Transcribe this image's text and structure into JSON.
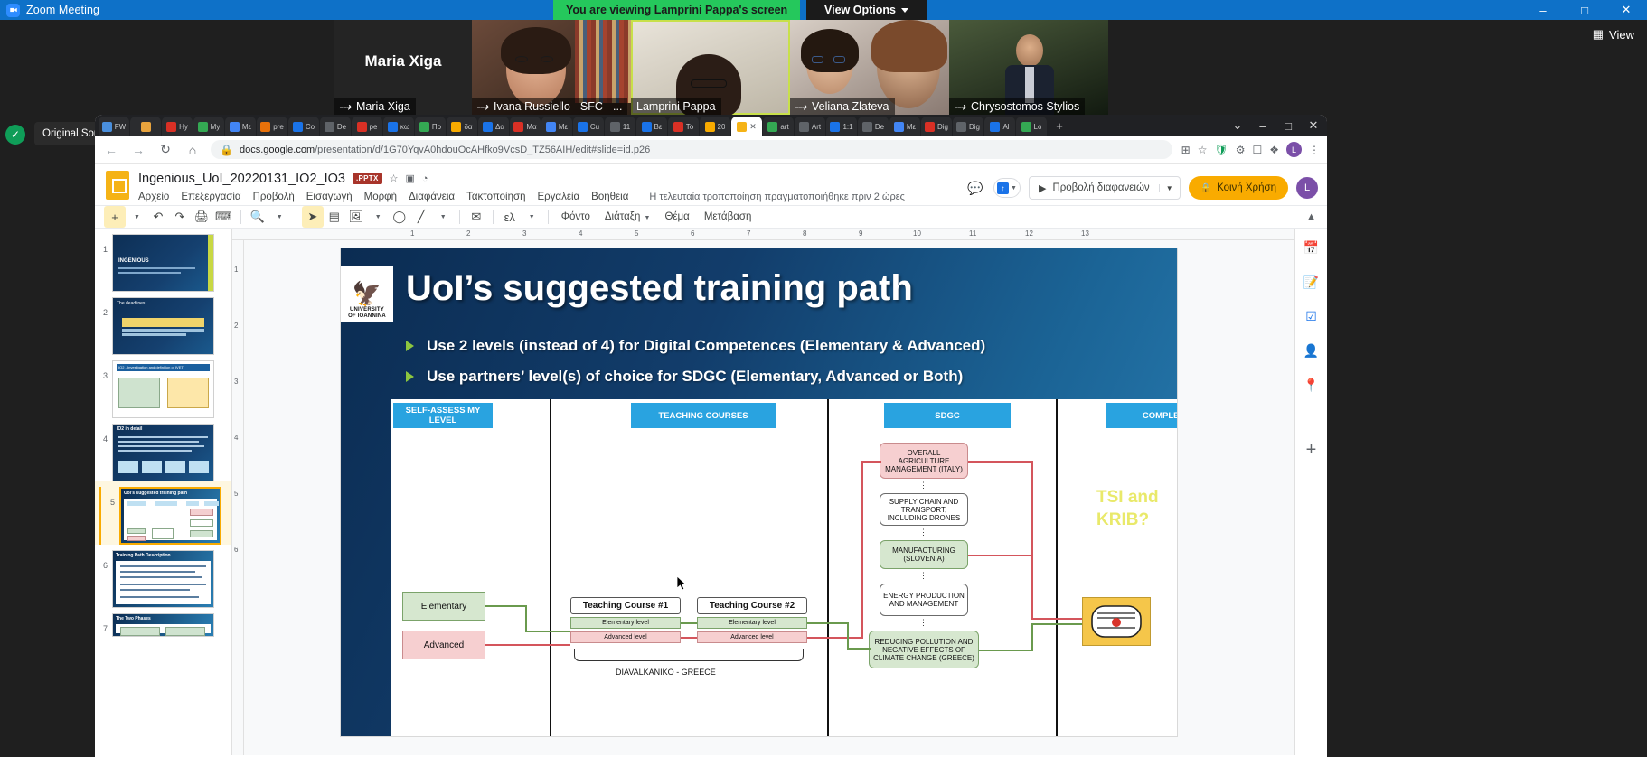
{
  "zoom": {
    "window_title": "Zoom Meeting",
    "viewing_banner": "You are viewing Lamprini Pappa's screen",
    "view_options": "View Options",
    "view_button": "View",
    "original_sound": "Original Sound: Off",
    "window_controls": {
      "minimize": "–",
      "maximize": "□",
      "close": "✕"
    },
    "participants": [
      {
        "name": "Maria Xiga",
        "muted": true,
        "big_name": "Maria Xiga"
      },
      {
        "name": "Ivana Russiello - SFC - ...",
        "muted": true
      },
      {
        "name": "Lamprini Pappa",
        "muted": false
      },
      {
        "name": "Veliana Zlateva",
        "muted": true
      },
      {
        "name": "Chrysostomos Stylios",
        "muted": true
      }
    ]
  },
  "chrome": {
    "tabs": [
      {
        "label": "FW",
        "color": "#4a8fdd"
      },
      {
        "label": "",
        "color": "#e8a33d"
      },
      {
        "label": "Hy",
        "color": "#d93025"
      },
      {
        "label": "My",
        "color": "#34a853"
      },
      {
        "label": "Mε",
        "color": "#4285f4"
      },
      {
        "label": "pre",
        "color": "#e8710a"
      },
      {
        "label": "Co",
        "color": "#1a73e8"
      },
      {
        "label": "De",
        "color": "#5f6368"
      },
      {
        "label": "pe",
        "color": "#d93025"
      },
      {
        "label": "κω",
        "color": "#1a73e8"
      },
      {
        "label": "Πο",
        "color": "#34a853"
      },
      {
        "label": "δα",
        "color": "#f9ab00"
      },
      {
        "label": "Δα",
        "color": "#1a73e8"
      },
      {
        "label": "Mα",
        "color": "#d93025"
      },
      {
        "label": "Mε",
        "color": "#4285f4"
      },
      {
        "label": "Cu",
        "color": "#1a73e8"
      },
      {
        "label": "11",
        "color": "#5f6368"
      },
      {
        "label": "Βε",
        "color": "#1a73e8"
      },
      {
        "label": "To",
        "color": "#d93025"
      },
      {
        "label": "20",
        "color": "#f9ab00"
      },
      {
        "label": "",
        "color": "#f5b316",
        "active": true
      },
      {
        "label": "art",
        "color": "#34a853"
      },
      {
        "label": "Art",
        "color": "#5f6368"
      },
      {
        "label": "1:1",
        "color": "#1a73e8"
      },
      {
        "label": "De",
        "color": "#5f6368"
      },
      {
        "label": "Mε",
        "color": "#4285f4"
      },
      {
        "label": "Dig",
        "color": "#d93025"
      },
      {
        "label": "Dig",
        "color": "#5f6368"
      },
      {
        "label": "Al",
        "color": "#1a73e8"
      },
      {
        "label": "Lo",
        "color": "#34a853"
      }
    ],
    "new_tab": "+",
    "tab_list": "⌄",
    "win_min": "–",
    "win_max": "□",
    "win_close": "✕",
    "url_prefix": "docs.google.com",
    "url_rest": "/presentation/d/1G70YqvA0hdouOcAHfko9VcsD_TZ56AIH/edit#slide=id.p26",
    "profile_initial": "L"
  },
  "slides": {
    "doc_title": "Ingenious_UoI_20220131_IO2_IO3",
    "file_badge": ".PPTX",
    "star_icon": "☆",
    "drive_icon": "▣",
    "cloud_icon": "◔",
    "menus": [
      "Αρχείο",
      "Επεξεργασία",
      "Προβολή",
      "Εισαγωγή",
      "Μορφή",
      "Διαφάνεια",
      "Τακτοποίηση",
      "Εργαλεία",
      "Βοήθεια"
    ],
    "last_edit": "Η τελευταία τροποποίηση πραγματοποιήθηκε πριν 2 ώρες",
    "present_label": "Προβολή διαφανειών",
    "share_label": "Κοινή Χρήση",
    "share_icon": "🔒",
    "account_initial": "L",
    "toolbar_text_buttons": [
      "Φόντο",
      "Διάταξη",
      "Θέμα",
      "Μετάβαση"
    ],
    "ruler_numbers": [
      "1",
      "2",
      "3",
      "4",
      "5",
      "6",
      "7",
      "8",
      "9",
      "10",
      "11",
      "12",
      "13"
    ],
    "vruler_numbers": [
      "1",
      "2",
      "3",
      "4",
      "5",
      "6"
    ],
    "thumbnails": [
      {
        "num": "1",
        "label": "INGENIOUS",
        "selected": false
      },
      {
        "num": "2",
        "label": "The deadlines",
        "selected": false
      },
      {
        "num": "3",
        "label": "IO2 - Investigation and definition of IVET Elementary/Digital Training Table",
        "selected": false
      },
      {
        "num": "4",
        "label": "IO2 in detail",
        "selected": false
      },
      {
        "num": "5",
        "label": "UoI's suggested training path",
        "selected": true
      },
      {
        "num": "6",
        "label": "Training Path Description",
        "selected": false
      },
      {
        "num": "7",
        "label": "The Two Phases",
        "selected": false
      }
    ]
  },
  "slide": {
    "university_line1": "UNIVERSITY",
    "university_line2": "OF IOANNINA",
    "title": "UoI’s suggested training path",
    "bullets": [
      "Use 2 levels (instead of 4) for Digital Competences (Elementary & Advanced)",
      "Use partners’ level(s) of choice for SDGC (Elementary, Advanced or Both)"
    ],
    "column_headers": [
      "SELF-ASSESS MY LEVEL",
      "TEACHING COURSES",
      "SDGC",
      "COMPLETION"
    ],
    "level_boxes": [
      {
        "label": "Elementary",
        "style": "green"
      },
      {
        "label": "Advanced",
        "style": "pink"
      }
    ],
    "teaching_courses": [
      {
        "title": "Teaching Course #1",
        "levels": [
          "Elementary level",
          "Advanced level"
        ]
      },
      {
        "title": "Teaching Course #2",
        "levels": [
          "Elementary level",
          "Advanced level"
        ]
      }
    ],
    "teaching_group_label": "DIAVALKANIKO - GREECE",
    "sdgc_boxes": [
      {
        "label": "OVERALL AGRICULTURE MANAGEMENT (ITALY)",
        "style": "pink"
      },
      {
        "label": "SUPPLY CHAIN AND TRANSPORT, INCLUDING DRONES",
        "style": "white"
      },
      {
        "label": "MANUFACTURING (SLOVENIA)",
        "style": "green"
      },
      {
        "label": "ENERGY PRODUCTION AND MANAGEMENT",
        "style": "white"
      },
      {
        "label": "REDUCING POLLUTION AND NEGATIVE EFFECTS OF CLIMATE CHANGE (GREECE)",
        "style": "green"
      }
    ],
    "completion_note": "TSI and KRIB?",
    "badge_icon": "certificate-badge"
  }
}
